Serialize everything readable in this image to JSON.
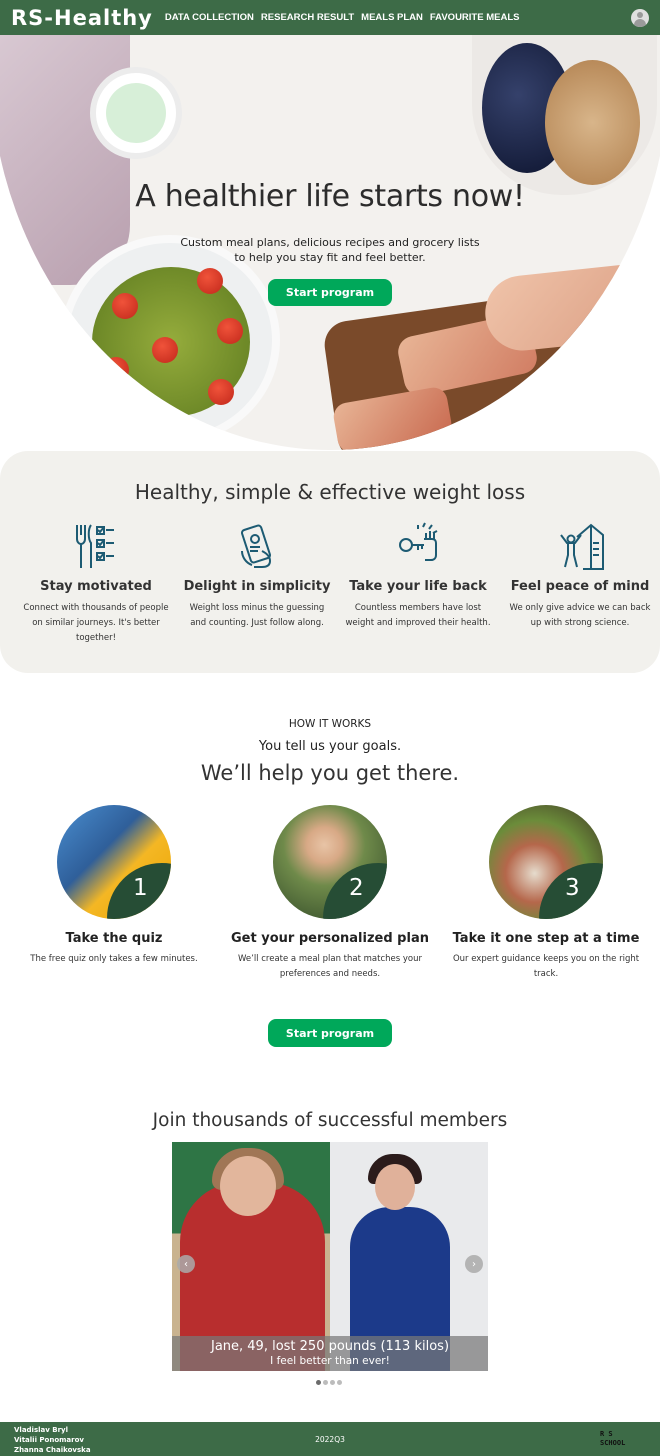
{
  "header": {
    "logo": "RS-Healthy",
    "nav": [
      "DATA COLLECTION",
      "RESEARCH RESULT",
      "MEALS PLAN",
      "FAVOURITE MEALS"
    ],
    "avatar_icon": "user-avatar-icon"
  },
  "hero": {
    "title": "A healthier life starts now!",
    "subtitle_line1": "Custom meal plans, delicious recipes and grocery lists",
    "subtitle_line2": "to help you stay fit and feel better.",
    "button": "Start program"
  },
  "features": {
    "title": "Healthy, simple & effective weight loss",
    "items": [
      {
        "icon": "fork-knife-checklist-icon",
        "title": "Stay motivated",
        "text": "Connect with thousands of people on similar journeys. It's better together!"
      },
      {
        "icon": "phone-in-hand-icon",
        "title": "Delight in simplicity",
        "text": "Weight loss minus the guessing and counting. Just follow along."
      },
      {
        "icon": "key-hand-icon",
        "title": "Take your life back",
        "text": "Countless members have lost weight and improved their health."
      },
      {
        "icon": "person-house-icon",
        "title": "Feel peace of mind",
        "text": "We only give advice we can back up with strong science."
      }
    ]
  },
  "how": {
    "eyebrow": "HOW IT WORKS",
    "subtitle": "You tell us your goals.",
    "title": "We’ll help you get there.",
    "steps": [
      {
        "num": "1",
        "title": "Take the quiz",
        "text": "The free quiz only takes a few minutes."
      },
      {
        "num": "2",
        "title": "Get your personalized plan",
        "text": "We’ll create a meal plan that matches your preferences and needs."
      },
      {
        "num": "3",
        "title": "Take it one step at a time",
        "text": "Our expert guidance keeps you on the right track."
      }
    ],
    "button": "Start program"
  },
  "members": {
    "title": "Join thousands of successful members",
    "caption_line1": "Jane, 49, lost 250 pounds (113 kilos)",
    "caption_line2": "I feel better than ever!",
    "prev": "‹",
    "next": "›",
    "slide_count": 4,
    "active_slide": 1
  },
  "footer": {
    "authors": [
      "Vladislav Bryl",
      "Vitalii Ponomarov",
      "Zhanna Chaikovska"
    ],
    "year": "2022Q3",
    "school_logo_lines": [
      "R  S",
      "SCHOOL"
    ]
  },
  "colors": {
    "header_bg": "#3d6b47",
    "button_green": "#00a85a",
    "icon_teal": "#1d5b73",
    "step_badge": "#264d35"
  }
}
